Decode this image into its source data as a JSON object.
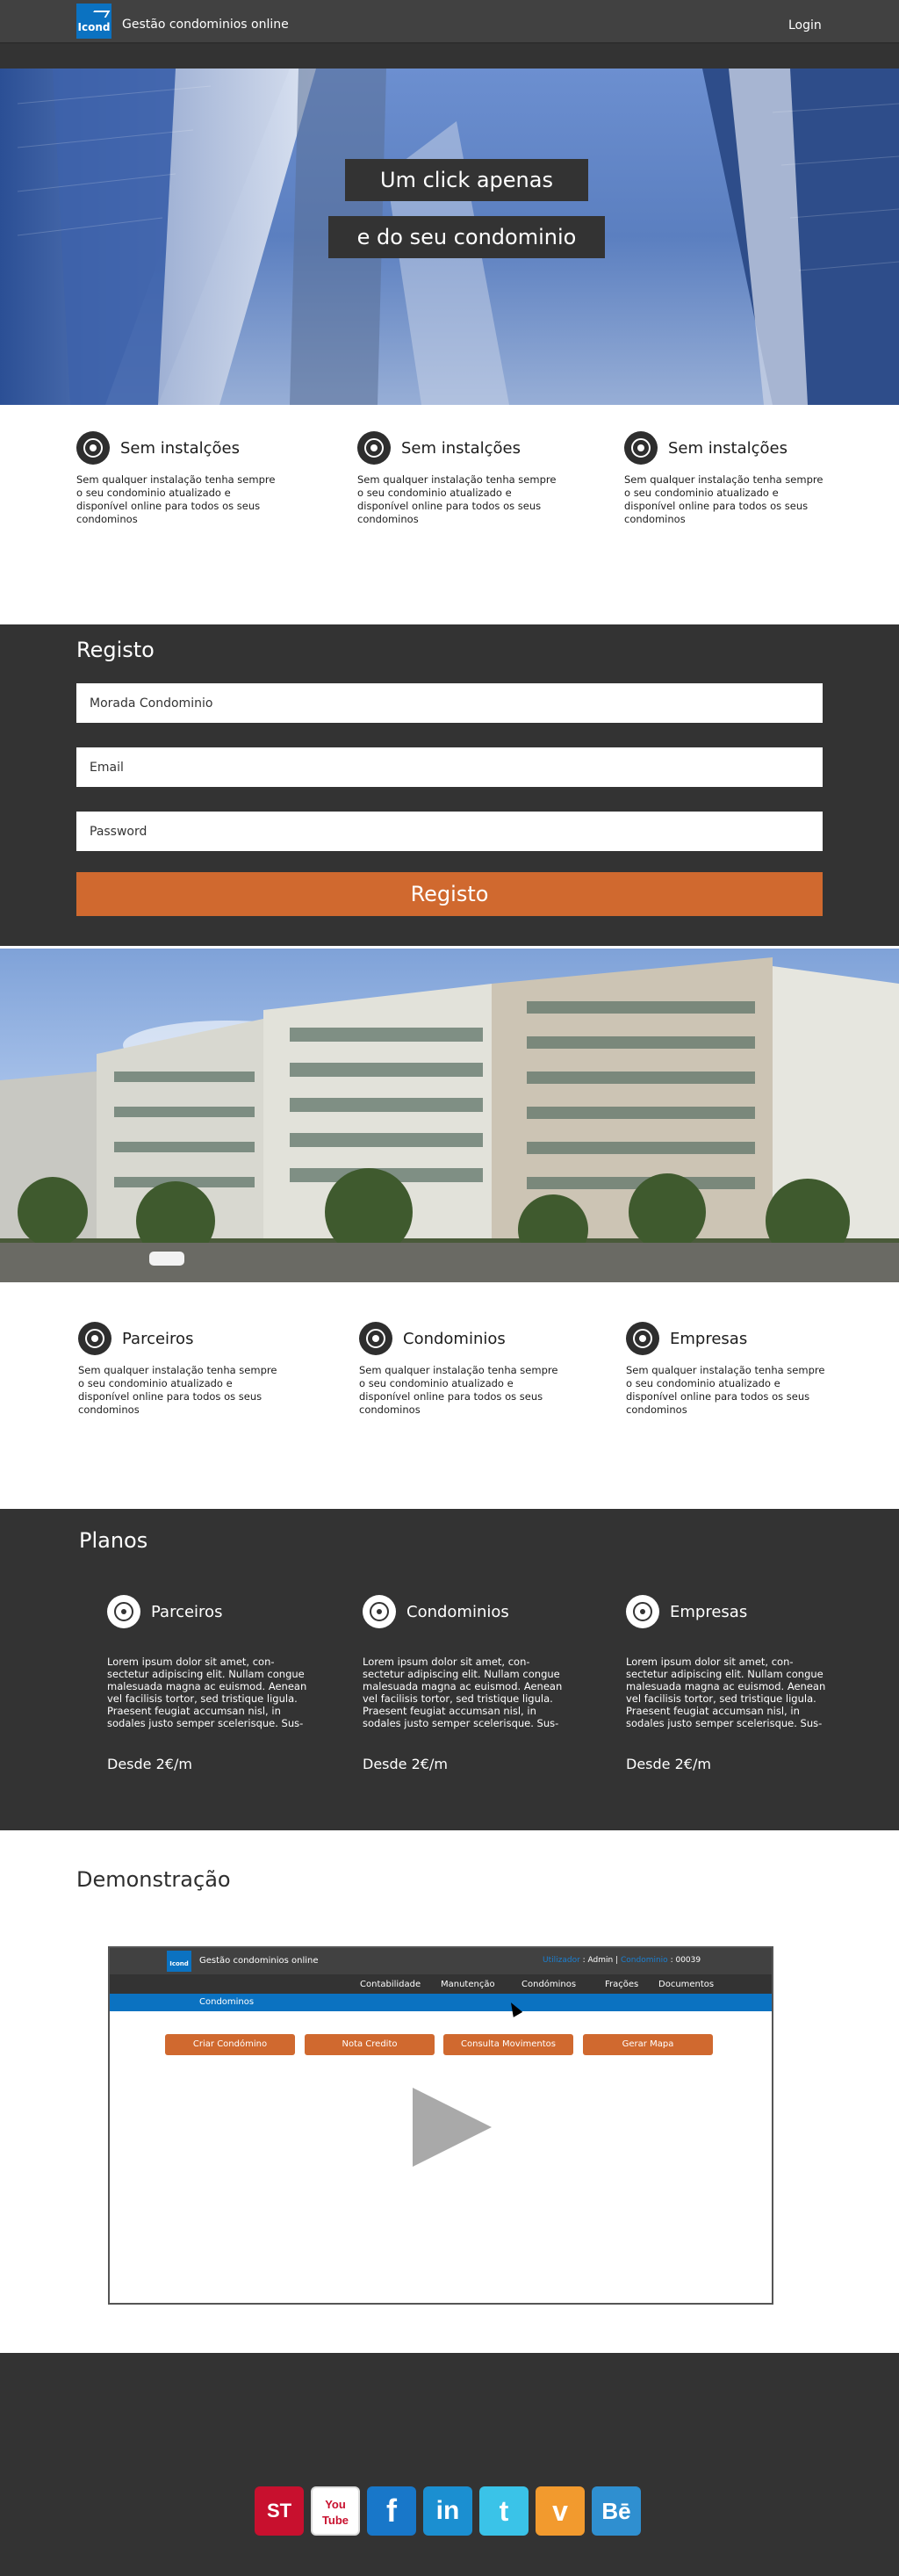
{
  "header": {
    "logo_text": "Icond",
    "brand": "Gestão condominios online",
    "login_label": "Login"
  },
  "hero": {
    "line1": "Um click apenas",
    "line2": "e do seu condominio"
  },
  "features_top": [
    {
      "title": "Sem instalções",
      "text": "Sem qualquer instalação tenha sempre o seu condominio atualizado e disponível online para todos os seus condominos"
    },
    {
      "title": "Sem instalções",
      "text": "Sem qualquer instalação tenha sempre o seu condominio atualizado e disponível online para todos os seus condominos"
    },
    {
      "title": "Sem instalções",
      "text": "Sem qualquer instalação tenha sempre o seu condominio atualizado e disponível online para todos os seus condominos"
    }
  ],
  "registo": {
    "title": "Registo",
    "address_placeholder": "Morada Condominio",
    "email_placeholder": "Email",
    "password_placeholder": "Password",
    "button_label": "Registo"
  },
  "features_bottom": [
    {
      "title": "Parceiros",
      "text": "Sem qualquer instalação tenha sempre o seu condominio atualizado e disponível online para todos os seus condominos"
    },
    {
      "title": "Condominios",
      "text": "Sem qualquer instalação tenha sempre o seu condominio atualizado e disponível online para todos os seus condominos"
    },
    {
      "title": "Empresas",
      "text": "Sem qualquer instalação tenha sempre o seu condominio atualizado e disponível online para todos os seus condominos"
    }
  ],
  "planos": {
    "title": "Planos",
    "items": [
      {
        "title": "Parceiros",
        "text": "Lorem ipsum dolor sit amet, con-sectetur adipiscing elit. Nullam congue malesuada magna ac euismod. Aenean vel facilisis tortor, sed tristique ligula. Praesent feugiat accumsan nisl, in sodales justo semper scelerisque. Sus-",
        "price": "Desde 2€/m"
      },
      {
        "title": "Condominios",
        "text": "Lorem ipsum dolor sit amet, con-sectetur adipiscing elit. Nullam congue malesuada magna ac euismod. Aenean vel facilisis tortor, sed tristique ligula. Praesent feugiat accumsan nisl, in sodales justo semper scelerisque. Sus-",
        "price": "Desde 2€/m"
      },
      {
        "title": "Empresas",
        "text": "Lorem ipsum dolor sit amet, con-sectetur adipiscing elit. Nullam congue malesuada magna ac euismod. Aenean vel facilisis tortor, sed tristique ligula. Praesent feugiat accumsan nisl, in sodales justo semper scelerisque. Sus-",
        "price": "Desde 2€/m"
      }
    ]
  },
  "demo": {
    "title": "Demonstração",
    "logo_text": "Icond",
    "brand": "Gestão condominios online",
    "user_prefix": "Utilizador",
    "user_name": "Admin",
    "condo_label": "Condominio",
    "condo_number": "00039",
    "nav": [
      "Contabilidade",
      "Manutenção",
      "Condóminos",
      "Frações",
      "Documentos"
    ],
    "bar_label": "Condominos",
    "buttons": [
      "Criar Condómino",
      "Nota Credito",
      "Consulta Movimentos",
      "Gerar Mapa"
    ]
  },
  "footer": {
    "social": [
      {
        "name": "stumbleupon",
        "label": "ST",
        "color": "#c8102e"
      },
      {
        "name": "youtube",
        "label": "You Tube",
        "color": "#ffffff"
      },
      {
        "name": "facebook",
        "label": "f",
        "color": "#1877c9"
      },
      {
        "name": "linkedin",
        "label": "in",
        "color": "#1b8fd1"
      },
      {
        "name": "twitter",
        "label": "t",
        "color": "#3ac3e8"
      },
      {
        "name": "vimeo",
        "label": "v",
        "color": "#f29a2e"
      },
      {
        "name": "behance",
        "label": "Bē",
        "color": "#2f8fd0"
      }
    ]
  }
}
